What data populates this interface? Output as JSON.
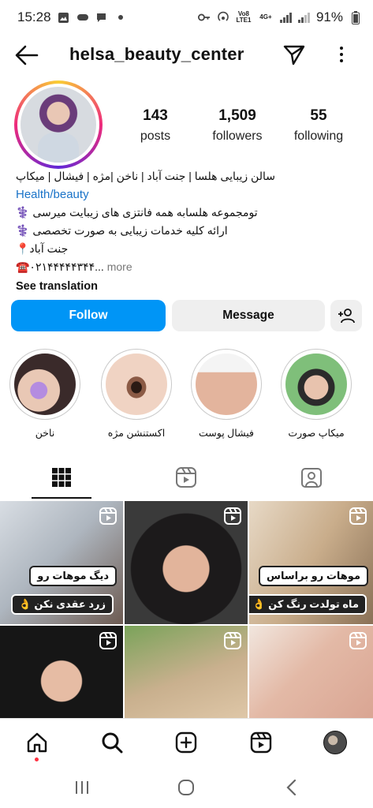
{
  "status_bar": {
    "time": "15:28",
    "battery": "91%",
    "net_top": "Vo8",
    "net_bottom": "LTE1",
    "net_type": "4G+"
  },
  "header": {
    "username": "helsa_beauty_center"
  },
  "profile": {
    "stats": [
      {
        "value": "143",
        "label": "posts"
      },
      {
        "value": "1,509",
        "label": "followers"
      },
      {
        "value": "55",
        "label": "following"
      }
    ],
    "bio": {
      "line1": "سالن زیبایی هلسا | جنت آباد | ناخن |مژه | فیشال | میکاپ",
      "category": "Health/beauty",
      "line2": "تومجموعه هلسابه همه فانتزی های زیبایت میرسی ⚕️",
      "line3": "ارائه کلیه خدمات زیبایی به صورت تخصصی ⚕️",
      "line4": "جنت آباد📍",
      "phone": "☎️۰۲۱۴۴۴۴۴۳۴۴...",
      "more": "more",
      "see_translation": "See translation"
    }
  },
  "actions": {
    "follow": "Follow",
    "message": "Message"
  },
  "highlights": [
    {
      "label": "ناخن"
    },
    {
      "label": "اکستنشن مژه"
    },
    {
      "label": "فیشال پوست"
    },
    {
      "label": "میکاپ صورت"
    }
  ],
  "posts": [
    {
      "caption1": "دیگ موهات رو",
      "caption2": "زرد عقدی نکن 👌"
    },
    {},
    {
      "caption1": "موهات رو براساس",
      "caption2": "ماه تولدت رنگ کن 👌"
    },
    {},
    {},
    {}
  ],
  "colors": {
    "accent": "#0095f6",
    "secondary_button": "#efefef",
    "notification_dot": "#ff3040"
  }
}
